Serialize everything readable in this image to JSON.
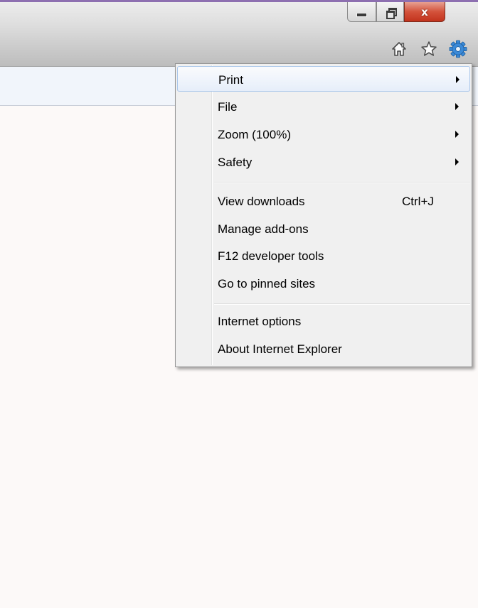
{
  "window_controls": {
    "minimize": "minimize-icon",
    "restore": "restore-icon",
    "close_glyph": "x"
  },
  "toolbar": {
    "icons": [
      "home-icon",
      "favorites-star-icon",
      "tools-gear-icon"
    ]
  },
  "colors": {
    "accent_border": "#8d6fb0",
    "menu_background": "#f0f0f0",
    "highlight_border": "#a9c6ea",
    "gear_blue": "#3b8ad8"
  },
  "tools_menu": {
    "items": [
      {
        "label": "Print",
        "submenu": true,
        "highlighted": true
      },
      {
        "label": "File",
        "submenu": true
      },
      {
        "label": "Zoom (100%)",
        "submenu": true
      },
      {
        "label": "Safety",
        "submenu": true
      },
      {
        "label": "View downloads",
        "shortcut": "Ctrl+J"
      },
      {
        "label": "Manage add-ons"
      },
      {
        "label": "F12 developer tools"
      },
      {
        "label": "Go to pinned sites"
      },
      {
        "label": "Internet options"
      },
      {
        "label": "About Internet Explorer"
      }
    ]
  }
}
